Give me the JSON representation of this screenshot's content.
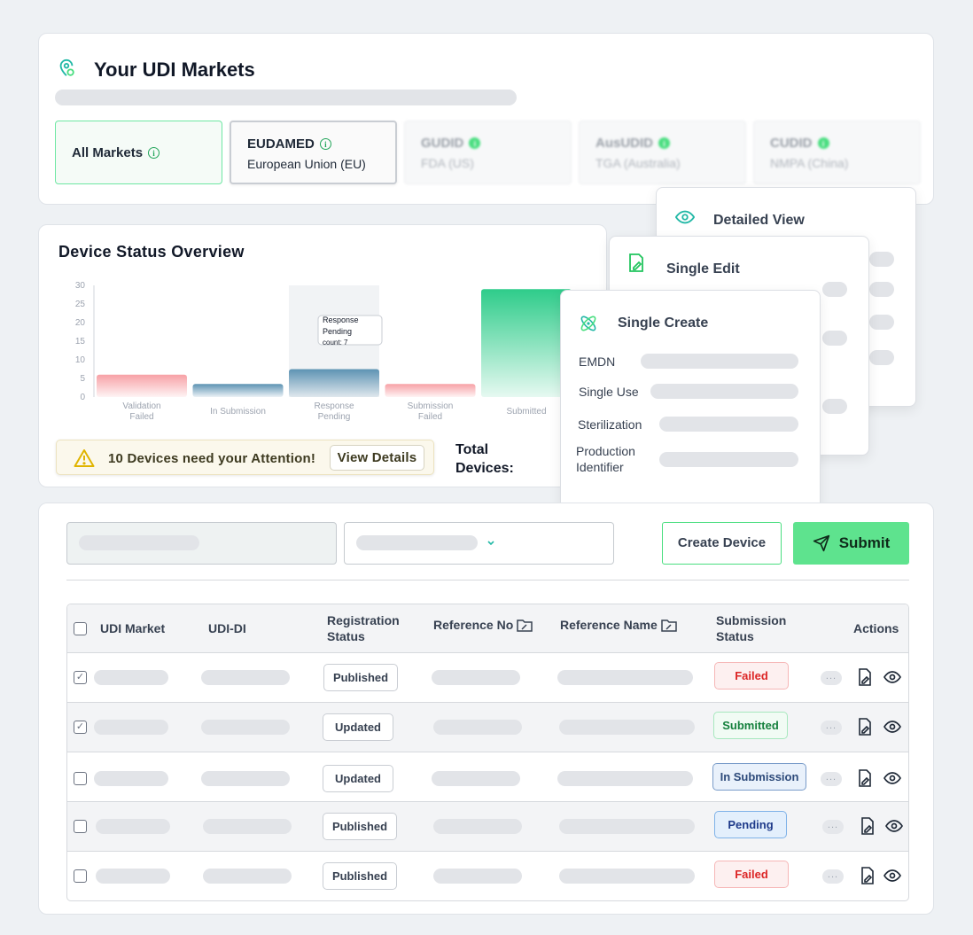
{
  "markets": {
    "title": "Your UDI Markets",
    "items": [
      {
        "code": "All Markets",
        "region": ""
      },
      {
        "code": "EUDAMED",
        "region": "European Union (EU)"
      },
      {
        "code": "GUDID",
        "region": "FDA (US)"
      },
      {
        "code": "AusUDID",
        "region": "TGA (Australia)"
      },
      {
        "code": "CUDID",
        "region": "NMPA (China)"
      }
    ]
  },
  "status_overview": {
    "title": "Device Status Overview",
    "attention_text": "10 Devices need your Attention!",
    "view_details_label": "View Details",
    "total_label": "Total Devices:"
  },
  "chart_data": {
    "type": "bar",
    "categories": [
      "Validation Failed",
      "In Submission",
      "Response Pending",
      "Submission Failed",
      "Submitted"
    ],
    "values": [
      6,
      3.5,
      7.5,
      3.5,
      29
    ],
    "ylim": [
      0,
      30
    ],
    "yticks": [
      0,
      5,
      10,
      15,
      20,
      25,
      30
    ],
    "grid": false,
    "tooltip": {
      "category": "Response Pending",
      "label": "count: 7"
    },
    "colors": [
      "#f7a1a6",
      "#5d93b3",
      "#5d93b3",
      "#f7a1a6",
      "#2ecc8a"
    ]
  },
  "popovers": {
    "detailed_view": "Detailed View",
    "single_edit": "Single Edit",
    "single_create": {
      "title": "Single Create",
      "fields": [
        "EMDN",
        "Single Use",
        "Sterilization",
        "Production Identifier"
      ]
    }
  },
  "toolbar": {
    "create_label": "Create Device",
    "submit_label": "Submit"
  },
  "table": {
    "headers": [
      "UDI Market",
      "UDI-DI",
      "Registration Status",
      "Reference No",
      "Reference Name",
      "Submission Status",
      "Actions"
    ],
    "rows": [
      {
        "checked": true,
        "registration": "Published",
        "submission": "Failed",
        "sclass": "s-failed"
      },
      {
        "checked": true,
        "registration": "Updated",
        "submission": "Submitted",
        "sclass": "s-submitted"
      },
      {
        "checked": false,
        "registration": "Updated",
        "submission": "In Submission",
        "sclass": "s-insub"
      },
      {
        "checked": false,
        "registration": "Published",
        "submission": "Pending",
        "sclass": "s-pending"
      },
      {
        "checked": false,
        "registration": "Published",
        "submission": "Failed",
        "sclass": "s-failed"
      }
    ]
  }
}
